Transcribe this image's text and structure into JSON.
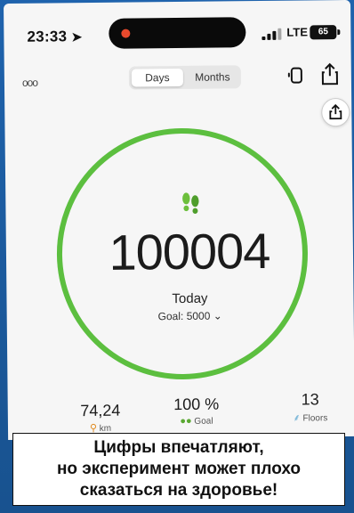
{
  "status_bar": {
    "time": "23:33",
    "network": "LTE",
    "battery": "65"
  },
  "toolbar": {
    "more": "ooo",
    "tabs": [
      {
        "label": "Days",
        "active": true
      },
      {
        "label": "Months",
        "active": false
      }
    ]
  },
  "progress": {
    "steps": "100004",
    "period": "Today",
    "goal": "Goal: 5000",
    "ring_fraction": 1.0,
    "ring_color": "#5cbf3f"
  },
  "stats": [
    {
      "value": "74,24",
      "label": "km",
      "icon": "distance-icon"
    },
    {
      "value": "100 %",
      "label": "Goal",
      "icon": "feet-icon"
    },
    {
      "value": "13",
      "label": "Floors",
      "icon": "stairs-icon"
    }
  ],
  "caption": {
    "line1": "Цифры впечатляют,",
    "line2": "но эксперимент может плохо",
    "line3": "сказаться на здоровье!"
  }
}
